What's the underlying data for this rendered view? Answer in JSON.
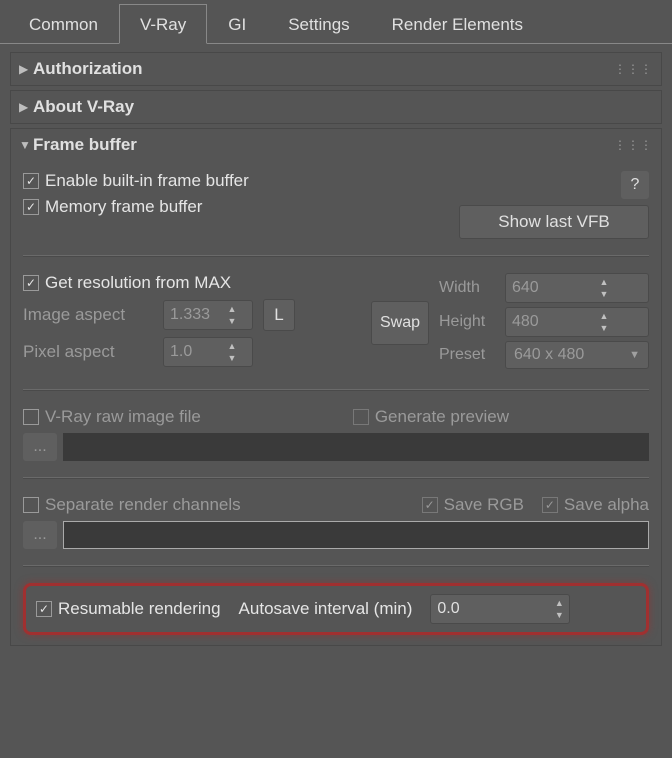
{
  "tabs": [
    "Common",
    "V-Ray",
    "GI",
    "Settings",
    "Render Elements"
  ],
  "active_tab": 1,
  "rollouts": {
    "authorization": {
      "title": "Authorization",
      "expanded": false
    },
    "about": {
      "title": "About V-Ray",
      "expanded": false
    },
    "framebuffer": {
      "title": "Frame buffer",
      "expanded": true,
      "enable_builtin_label": "Enable built-in frame buffer",
      "enable_builtin_checked": true,
      "memory_fb_label": "Memory frame buffer",
      "memory_fb_checked": true,
      "show_vfb_label": "Show last VFB",
      "help_label": "?",
      "get_res_label": "Get resolution from MAX",
      "get_res_checked": true,
      "swap_label": "Swap",
      "image_aspect_label": "Image aspect",
      "image_aspect_value": "1.333",
      "lock_label": "L",
      "pixel_aspect_label": "Pixel aspect",
      "pixel_aspect_value": "1.0",
      "width_label": "Width",
      "width_value": "640",
      "height_label": "Height",
      "height_value": "480",
      "preset_label": "Preset",
      "preset_value": "640 x 480",
      "raw_image_label": "V-Ray raw image file",
      "raw_image_checked": false,
      "gen_preview_label": "Generate preview",
      "gen_preview_checked": false,
      "ellipsis": "...",
      "sep_channels_label": "Separate render channels",
      "sep_channels_checked": false,
      "save_rgb_label": "Save RGB",
      "save_rgb_checked": true,
      "save_alpha_label": "Save alpha",
      "save_alpha_checked": true,
      "resumable_label": "Resumable rendering",
      "resumable_checked": true,
      "autosave_label": "Autosave interval (min)",
      "autosave_value": "0.0"
    }
  }
}
